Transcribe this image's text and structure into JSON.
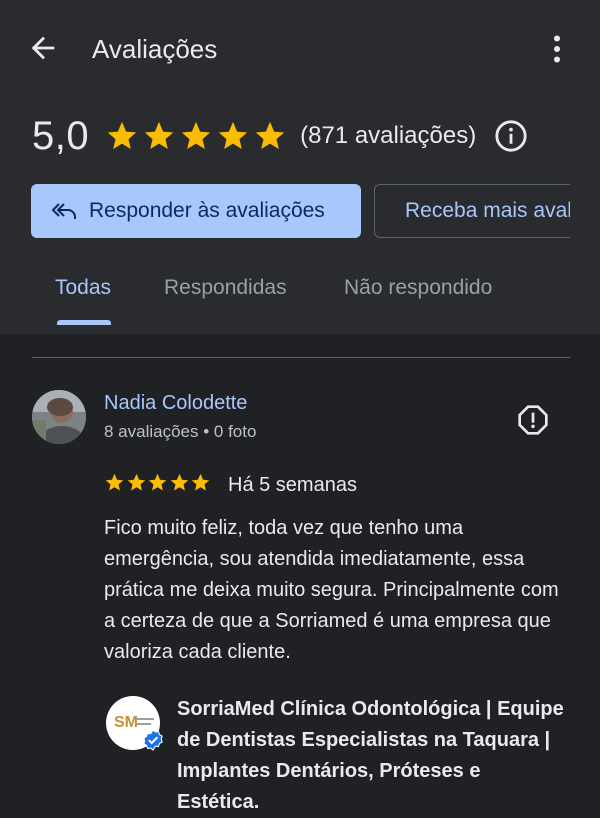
{
  "header": {
    "title": "Avaliações",
    "back_icon": "arrow-back-icon",
    "more_icon": "more-vertical-icon"
  },
  "summary": {
    "rating": "5,0",
    "stars": 5,
    "count_text": "(871 avaliações)",
    "info_icon": "info-icon",
    "star_color": "#fbbc04"
  },
  "actions": {
    "reply_label": "Responder às avaliações",
    "share_label": "Receba mais avaliações"
  },
  "tabs": [
    {
      "label": "Todas",
      "active": true
    },
    {
      "label": "Respondidas",
      "active": false
    },
    {
      "label": "Não respondido",
      "active": false
    }
  ],
  "review": {
    "name": "Nadia Colodette",
    "meta": "8 avaliações • 0 foto",
    "stars": 5,
    "date": "Há 5 semanas",
    "text": "Fico muito feliz, toda vez que tenho uma emergência, sou atendida imediatamente, essa prática me deixa muito segura. Principalmente com a certeza de que a Sorriamed é uma empresa que valoriza cada cliente."
  },
  "owner_reply": {
    "name": "SorriaMed Clínica Odontológica | Equipe de Dentistas Especialistas na Taquara | Implantes Dentários, Próteses e Estética.",
    "logo_text": "SM",
    "logo_subtext": "ODONTOLOGIA AVANÇADA"
  },
  "colors": {
    "background": "#202124",
    "header_bg": "#2a2b2f",
    "accent": "#a8c7fa",
    "star": "#fbbc04",
    "verified": "#1a73e8"
  }
}
